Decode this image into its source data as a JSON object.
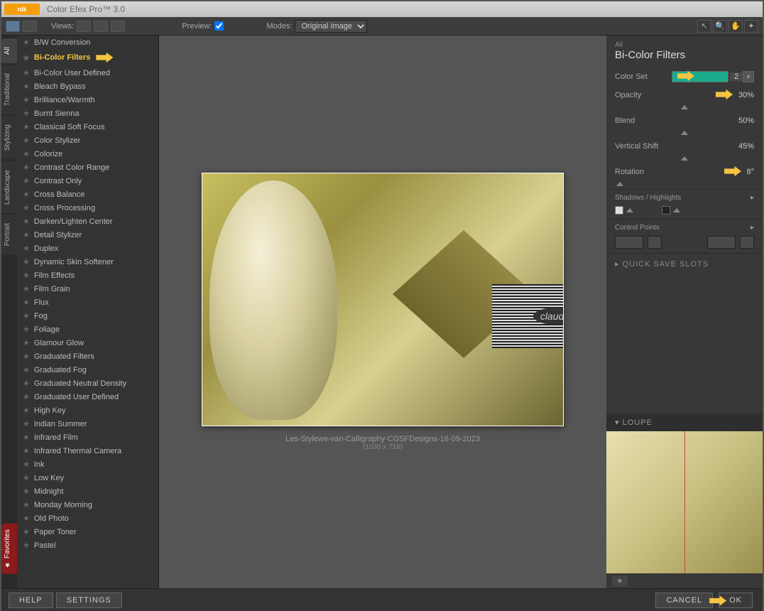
{
  "titlebar": {
    "app_name": "Color Efex Pro™ 3.0"
  },
  "toolbar": {
    "views_label": "Views:",
    "preview_label": "Preview:",
    "modes_label": "Modes:",
    "modes_value": "Original Image"
  },
  "tabs": {
    "all": "All",
    "traditional": "Traditional",
    "stylizing": "Stylizing",
    "landscape": "Landscape",
    "portrait": "Portrait",
    "favorites": "★ Favorites"
  },
  "filters": [
    "B/W Conversion",
    "Bi-Color Filters",
    "Bi-Color User Defined",
    "Bleach Bypass",
    "Brilliance/Warmth",
    "Burnt Sienna",
    "Classical Soft Focus",
    "Color Stylizer",
    "Colorize",
    "Contrast Color Range",
    "Contrast Only",
    "Cross Balance",
    "Cross Processing",
    "Darken/Lighten Center",
    "Detail Stylizer",
    "Duplex",
    "Dynamic Skin Softener",
    "Film Effects",
    "Film Grain",
    "Flux",
    "Fog",
    "Foliage",
    "Glamour Glow",
    "Graduated Filters",
    "Graduated Fog",
    "Graduated Neutral Density",
    "Graduated User Defined",
    "High Key",
    "Indian Summer",
    "Infrared Film",
    "Infrared Thermal Camera",
    "Ink",
    "Low Key",
    "Midnight",
    "Monday Morning",
    "Old Photo",
    "Paper Toner",
    "Pastel"
  ],
  "selected_filter_index": 1,
  "preview": {
    "filename": "Les-Stylewe-van-Calligraphy-CGSFDesigns-16-09-2023",
    "dimensions": "(1030 x 716)",
    "watermark": "claudia"
  },
  "panel": {
    "category": "All",
    "title": "Bi-Color Filters",
    "color_set_label": "Color Set",
    "color_set_value": "2",
    "color_set_swatch": "#1aaa8a",
    "opacity_label": "Opacity",
    "opacity_value": "30%",
    "blend_label": "Blend",
    "blend_value": "50%",
    "vshift_label": "Vertical Shift",
    "vshift_value": "45%",
    "rotation_label": "Rotation",
    "rotation_value": "8°",
    "shadows_label": "Shadows / Highlights",
    "control_points_label": "Control Points",
    "quick_save": "QUICK SAVE SLOTS",
    "loupe_label": "LOUPE"
  },
  "footer": {
    "help": "HELP",
    "settings": "SETTINGS",
    "cancel": "CANCEL",
    "ok": "OK"
  }
}
